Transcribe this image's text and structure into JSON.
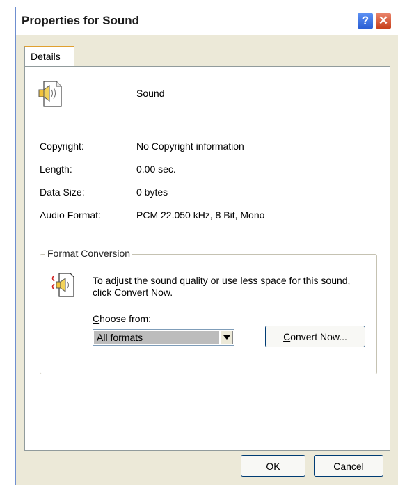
{
  "window": {
    "title": "Properties for Sound"
  },
  "tabs": [
    {
      "label": "Details"
    }
  ],
  "details": {
    "name": "Sound",
    "rows": [
      {
        "label": "Copyright:",
        "value": "No Copyright information"
      },
      {
        "label": "Length:",
        "value": "0.00 sec."
      },
      {
        "label": "Data Size:",
        "value": "0 bytes"
      },
      {
        "label": "Audio Format:",
        "value": "PCM 22.050 kHz, 8 Bit, Mono"
      }
    ]
  },
  "conversion": {
    "group_title": "Format Conversion",
    "description": "To adjust the sound quality or use less space for this sound, click Convert Now.",
    "choose_label_prefix": "",
    "choose_label_accel": "C",
    "choose_label_rest": "hoose from:",
    "select_value": "All formats",
    "convert_accel": "C",
    "convert_rest": "onvert Now..."
  },
  "buttons": {
    "ok": "OK",
    "cancel": "Cancel"
  },
  "colors": {
    "titlebar_text": "#1b1b1b",
    "close_button": "#c8401c",
    "help_button": "#2a5fd5",
    "tab_accent": "#e0a030"
  },
  "icons": {
    "help": "?",
    "close": "✕",
    "dropdown": "▼",
    "sound_file": "speaker-document-icon",
    "convert": "convert-arrows-icon"
  }
}
